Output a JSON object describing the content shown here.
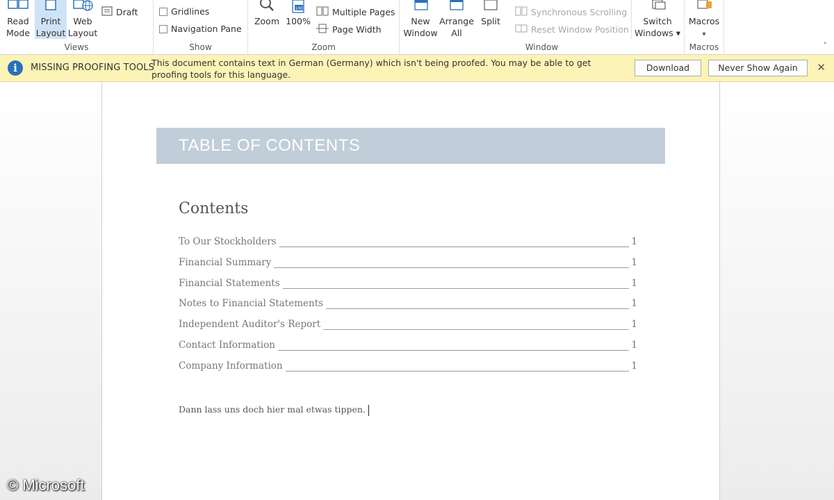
{
  "ribbon": {
    "views": {
      "label": "Views",
      "read_mode": "Read\nMode",
      "print_layout": "Print\nLayout",
      "web_layout": "Web\nLayout",
      "draft": "Draft"
    },
    "show": {
      "label": "Show",
      "gridlines": "Gridlines",
      "navigation_pane": "Navigation Pane"
    },
    "zoom": {
      "label": "Zoom",
      "zoom": "Zoom",
      "hundred": "100%",
      "multiple_pages": "Multiple Pages",
      "page_width": "Page Width"
    },
    "window": {
      "label": "Window",
      "new_window": "New\nWindow",
      "arrange_all": "Arrange\nAll",
      "split": "Split",
      "synchronous_scrolling": "Synchronous Scrolling",
      "reset_window_position": "Reset Window Position",
      "switch_windows": "Switch\nWindows ▾"
    },
    "macros": {
      "label": "Macros",
      "macros": "Macros",
      "dropdown": "▾"
    },
    "collapse_glyph": "˄"
  },
  "message_bar": {
    "title": "MISSING PROOFING TOOLS",
    "text": "This document contains text in German (Germany) which isn't being proofed. You may be able to get proofing tools for this language.",
    "download": "Download",
    "never_show_again": "Never Show Again",
    "close": "✕",
    "info_glyph": "i"
  },
  "document": {
    "banner": "TABLE OF CONTENTS",
    "contents_heading": "Contents",
    "toc": [
      {
        "text": "To Our Stockholders",
        "page": "1"
      },
      {
        "text": "Financial Summary",
        "page": "1"
      },
      {
        "text": "Financial Statements",
        "page": "1"
      },
      {
        "text": "Notes to Financial Statements",
        "page": "1"
      },
      {
        "text": "Independent Auditor's Report",
        "page": "1"
      },
      {
        "text": "Contact Information",
        "page": "1"
      },
      {
        "text": "Company Information",
        "page": "1"
      }
    ],
    "body_text": "Dann lass uns doch hier mal etwas tippen."
  },
  "watermark": "© Microsoft",
  "colors": {
    "accent_blue": "#2a70b8",
    "message_bar_bg": "#fcf3b6",
    "banner_bg": "#c1cdd8",
    "active_button": "#cfe3f7"
  }
}
